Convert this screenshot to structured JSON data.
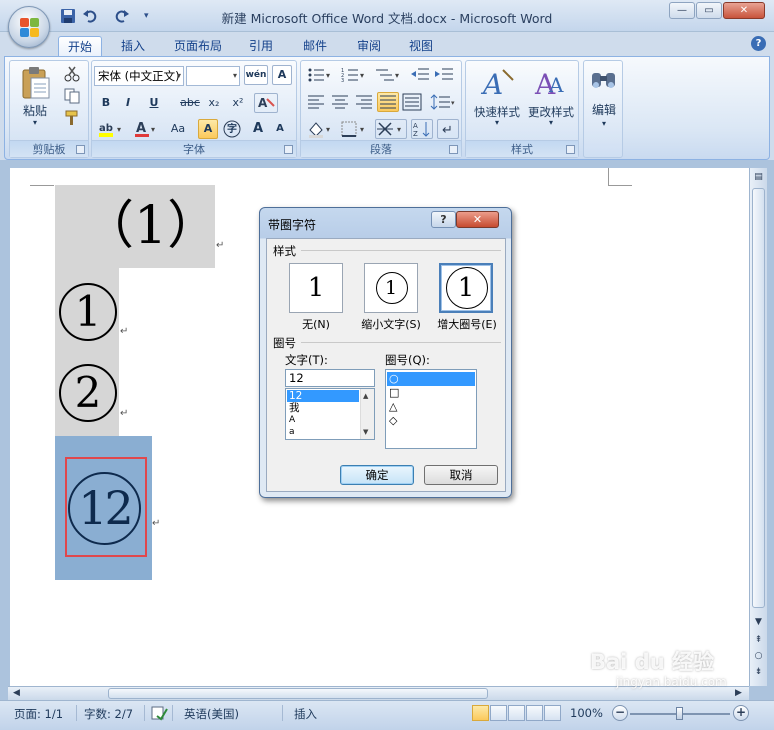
{
  "window": {
    "title": "新建 Microsoft Office Word 文档.docx - Microsoft Word",
    "controls": {
      "minimize": "—",
      "maximize": "▭",
      "close": "✕"
    }
  },
  "tabs": [
    "开始",
    "插入",
    "页面布局",
    "引用",
    "邮件",
    "审阅",
    "视图"
  ],
  "active_tab": "开始",
  "ribbon": {
    "clipboard": {
      "paste": "粘贴",
      "label": "剪贴板"
    },
    "font": {
      "font_name": "宋体 (中文正文)",
      "font_size": "",
      "buttons": {
        "bold": "B",
        "italic": "I",
        "underline": "U",
        "strike": "abc",
        "subscript": "x₂",
        "superscript": "x²",
        "grow": "A",
        "shrink": "A",
        "case": "Aa",
        "char_shade": "A",
        "enclose": "字",
        "phonetic": "wén",
        "border": "A"
      },
      "label": "字体"
    },
    "paragraph": {
      "label": "段落"
    },
    "styles": {
      "quick": "快速样式",
      "change": "更改样式",
      "label": "样式"
    },
    "editing": {
      "label": "编辑"
    }
  },
  "document": {
    "line1": "（1）",
    "line2": "1",
    "line3": "2",
    "line4": "12",
    "para_mark": "↵"
  },
  "dialog": {
    "title": "带圈字符",
    "help": "?",
    "close": "✕",
    "section_style": "样式",
    "styles": [
      {
        "glyph": "1",
        "label": "无(N)"
      },
      {
        "glyph": "1",
        "label": "缩小文字(S)"
      },
      {
        "glyph": "1",
        "label": "增大圈号(E)"
      }
    ],
    "selected_style": "增大圈号(E)",
    "section_enclosure": "圈号",
    "text_label": "文字(T):",
    "text_value": "12",
    "text_list": [
      "12",
      "我",
      "A",
      "a"
    ],
    "enclosure_label": "圈号(Q):",
    "enclosure_list": [
      "○",
      "□",
      "△",
      "◇"
    ],
    "ok": "确定",
    "cancel": "取消"
  },
  "statusbar": {
    "page": "页面: 1/1",
    "words": "字数: 2/7",
    "language": "英语(美国)",
    "mode": "插入",
    "zoom": "100%",
    "zoom_percent": 100
  },
  "watermark": {
    "brand": "Bai du 经验",
    "url": "jingyan.baidu.com"
  },
  "colors": {
    "selection_gray": "#d6d6d6",
    "selection_blue": "#8aaed2",
    "highlight_box": "#e0474c",
    "enclosed_char": "#0e2a4d"
  }
}
